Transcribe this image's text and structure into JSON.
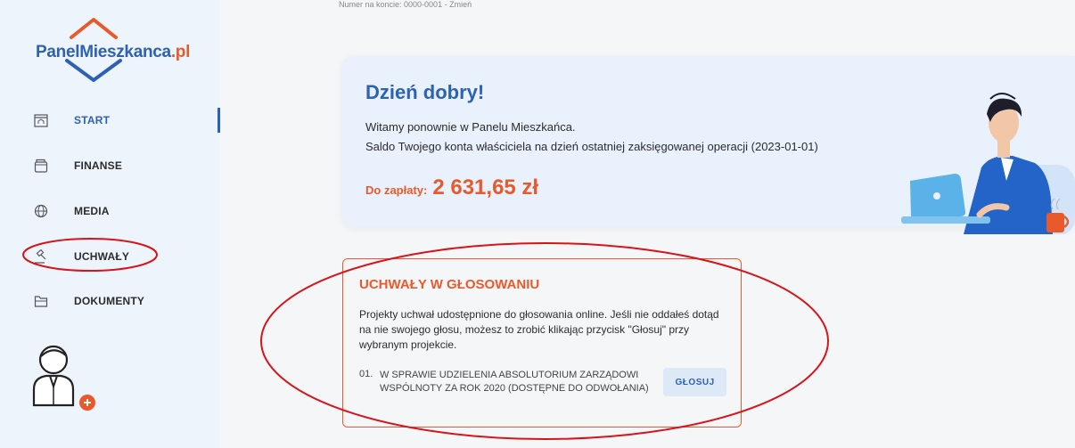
{
  "app": {
    "logo_main": "PanelMieszkanca",
    "logo_suffix": ".pl",
    "top_fragment": "Numer na koncie: 0000-0001 - Zmień"
  },
  "sidebar": {
    "items": [
      {
        "label": "START",
        "icon": "home-window-icon",
        "active": true
      },
      {
        "label": "FINANSE",
        "icon": "wallet-icon",
        "active": false
      },
      {
        "label": "MEDIA",
        "icon": "globe-icon",
        "active": false
      },
      {
        "label": "UCHWAŁY",
        "icon": "gavel-icon",
        "active": false
      },
      {
        "label": "DOKUMENTY",
        "icon": "folder-icon",
        "active": false
      }
    ],
    "avatar_icon": "user-add-avatar-icon"
  },
  "welcome": {
    "title": "Dzień dobry!",
    "line1": "Witamy ponownie w Panelu Mieszkańca.",
    "line2": "Saldo Twojego konta właściciela na dzień ostatniej zaksięgowanej operacji (2023-01-01)",
    "due_label": "Do zapłaty:",
    "due_amount": "2 631,65 zł"
  },
  "votes": {
    "title": "UCHWAŁY W GŁOSOWANIU",
    "description": "Projekty uchwał udostępnione do głosowania online. Jeśli nie oddałeś dotąd na nie swojego głosu, możesz to zrobić klikając przycisk \"Głosuj\" przy wybranym projekcie.",
    "items": [
      {
        "number": "01.",
        "title": "W SPRAWIE UDZIELENIA ABSOLUTORIUM ZARZĄDOWI WSPÓLNOTY ZA ROK 2020 (DOSTĘPNE DO ODWOŁANIA)",
        "button": "GŁOSUJ"
      }
    ]
  },
  "colors": {
    "brand_blue": "#2d62b3",
    "accent_orange": "#e85a2c",
    "annotation_red": "#d7141a",
    "sidebar_bg": "#eef4fb"
  }
}
